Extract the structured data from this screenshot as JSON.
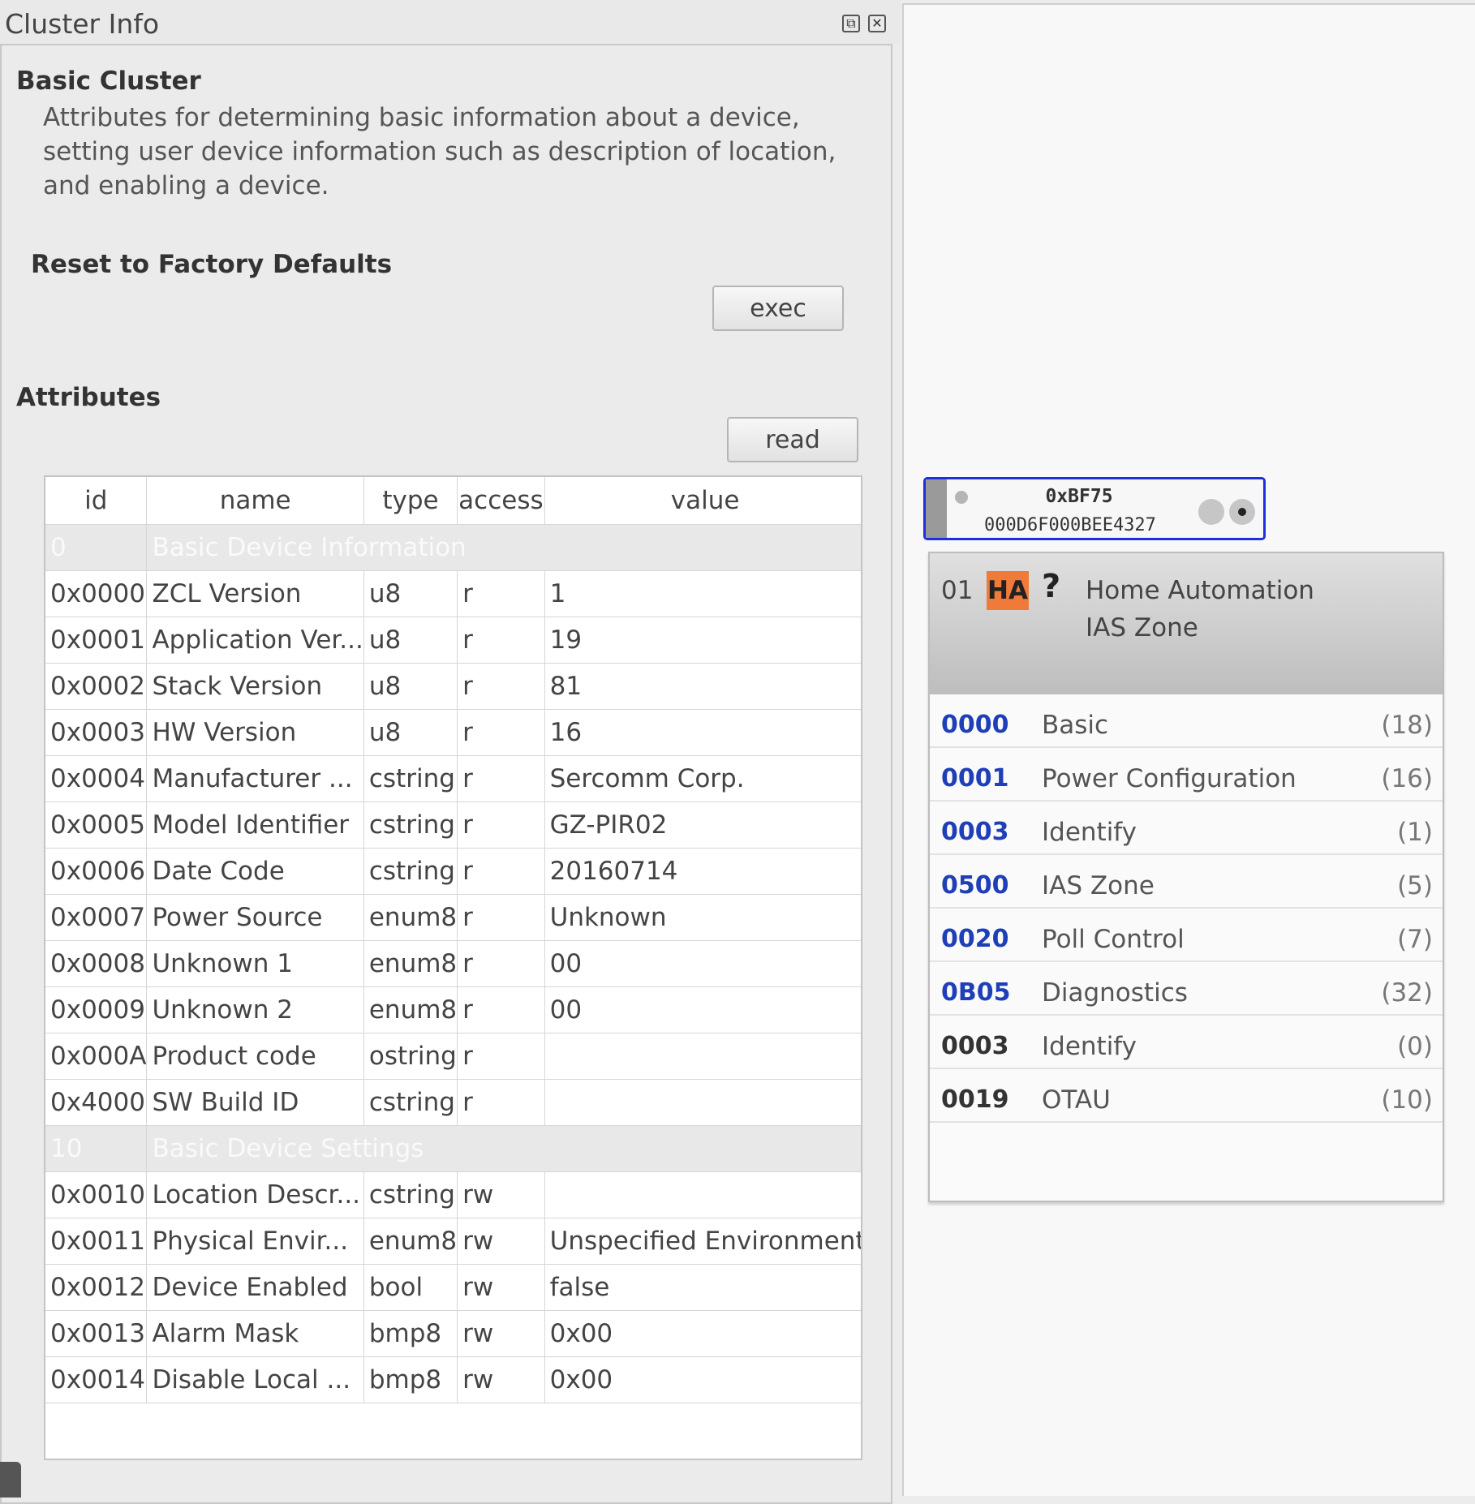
{
  "dock": {
    "title": "Cluster Info",
    "float_glyph": "⧉",
    "close_glyph": "✕"
  },
  "cluster": {
    "heading": "Basic Cluster",
    "description": "Attributes for determining basic information about a device, setting user device information such as description of location, and enabling a device."
  },
  "reset": {
    "heading": "Reset to Factory Defaults",
    "exec_label": "exec"
  },
  "attributes": {
    "heading": "Attributes",
    "read_label": "read",
    "columns": [
      "id",
      "name",
      "type",
      "access",
      "value"
    ],
    "rows": [
      {
        "group": true,
        "id": "0",
        "name": "Basic Device Information"
      },
      {
        "id": "0x0000",
        "name": "ZCL Version",
        "type": "u8",
        "access": "r",
        "value": "1"
      },
      {
        "id": "0x0001",
        "name": "Application Ver...",
        "type": "u8",
        "access": "r",
        "value": "19"
      },
      {
        "id": "0x0002",
        "name": "Stack Version",
        "type": "u8",
        "access": "r",
        "value": "81"
      },
      {
        "id": "0x0003",
        "name": "HW Version",
        "type": "u8",
        "access": "r",
        "value": "16"
      },
      {
        "id": "0x0004",
        "name": "Manufacturer ...",
        "type": "cstring",
        "access": "r",
        "value": "Sercomm Corp."
      },
      {
        "id": "0x0005",
        "name": "Model Identifier",
        "type": "cstring",
        "access": "r",
        "value": "GZ-PIR02"
      },
      {
        "id": "0x0006",
        "name": "Date Code",
        "type": "cstring",
        "access": "r",
        "value": "20160714"
      },
      {
        "id": "0x0007",
        "name": "Power Source",
        "type": "enum8",
        "access": "r",
        "value": "Unknown"
      },
      {
        "id": "0x0008",
        "name": "Unknown 1",
        "type": "enum8",
        "access": "r",
        "value": "00"
      },
      {
        "id": "0x0009",
        "name": "Unknown 2",
        "type": "enum8",
        "access": "r",
        "value": "00"
      },
      {
        "id": "0x000A",
        "name": "Product code",
        "type": "ostring",
        "access": "r",
        "value": ""
      },
      {
        "id": "0x4000",
        "name": "SW Build ID",
        "type": "cstring",
        "access": "r",
        "value": ""
      },
      {
        "group": true,
        "id": "10",
        "name": "Basic Device Settings"
      },
      {
        "id": "0x0010",
        "name": "Location Descr...",
        "type": "cstring",
        "access": "rw",
        "value": ""
      },
      {
        "id": "0x0011",
        "name": "Physical Envir...",
        "type": "enum8",
        "access": "rw",
        "value": "Unspecified Environment"
      },
      {
        "id": "0x0012",
        "name": "Device Enabled",
        "type": "bool",
        "access": "rw",
        "value": "false"
      },
      {
        "id": "0x0013",
        "name": "Alarm Mask",
        "type": "bmp8",
        "access": "rw",
        "value": "0x00"
      },
      {
        "id": "0x0014",
        "name": "Disable Local ...",
        "type": "bmp8",
        "access": "rw",
        "value": "0x00"
      }
    ]
  },
  "node": {
    "nwk_address": "0xBF75",
    "ext_address": "000D6F000BEE4327",
    "selected_color": "#1f2fe0",
    "endpoint": {
      "number": "01",
      "profile_badge": "HA",
      "badge_color": "#f07a3a",
      "unknown_glyph": "?",
      "profile": "Home Automation",
      "device": "IAS Zone",
      "clusters": [
        {
          "id": "0000",
          "name": "Basic",
          "count": "(18)",
          "direction": "in"
        },
        {
          "id": "0001",
          "name": "Power Configuration",
          "count": "(16)",
          "direction": "in"
        },
        {
          "id": "0003",
          "name": "Identify",
          "count": "(1)",
          "direction": "in"
        },
        {
          "id": "0500",
          "name": "IAS Zone",
          "count": "(5)",
          "direction": "in"
        },
        {
          "id": "0020",
          "name": "Poll Control",
          "count": "(7)",
          "direction": "in"
        },
        {
          "id": "0B05",
          "name": "Diagnostics",
          "count": "(32)",
          "direction": "in"
        },
        {
          "id": "0003",
          "name": "Identify",
          "count": "(0)",
          "direction": "out"
        },
        {
          "id": "0019",
          "name": "OTAU",
          "count": "(10)",
          "direction": "out"
        }
      ]
    }
  }
}
